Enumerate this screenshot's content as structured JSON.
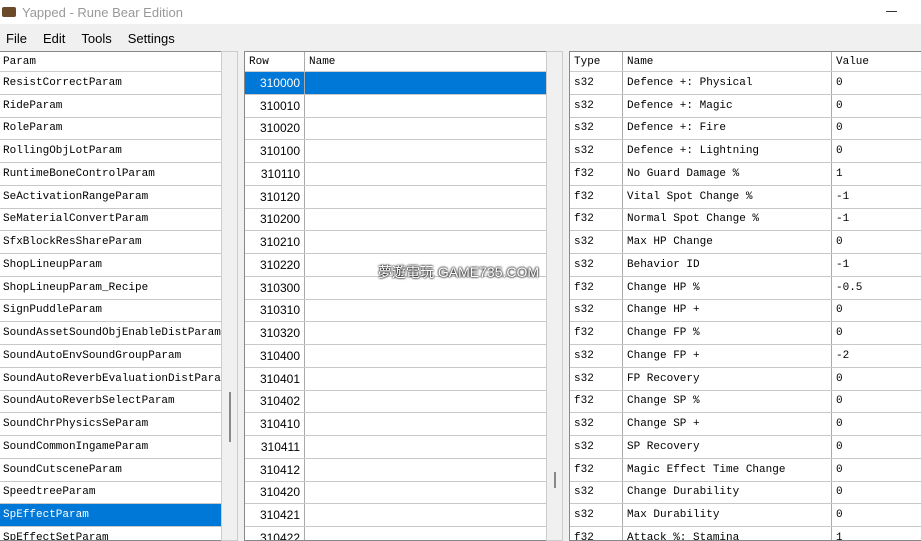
{
  "window": {
    "title": "Yapped - Rune Bear Edition"
  },
  "menu": [
    "File",
    "Edit",
    "Tools",
    "Settings"
  ],
  "params": {
    "header": "Param",
    "items": [
      "ResistCorrectParam",
      "RideParam",
      "RoleParam",
      "RollingObjLotParam",
      "RuntimeBoneControlParam",
      "SeActivationRangeParam",
      "SeMaterialConvertParam",
      "SfxBlockResShareParam",
      "ShopLineupParam",
      "ShopLineupParam_Recipe",
      "SignPuddleParam",
      "SoundAssetSoundObjEnableDistParam",
      "SoundAutoEnvSoundGroupParam",
      "SoundAutoReverbEvaluationDistParam",
      "SoundAutoReverbSelectParam",
      "SoundChrPhysicsSeParam",
      "SoundCommonIngameParam",
      "SoundCutsceneParam",
      "SpeedtreeParam",
      "SpEffectParam",
      "SpEffectSetParam"
    ],
    "selected": 19
  },
  "rows": {
    "header_row": "Row",
    "header_name": "Name",
    "items": [
      "310000",
      "310010",
      "310020",
      "310100",
      "310110",
      "310120",
      "310200",
      "310210",
      "310220",
      "310300",
      "310310",
      "310320",
      "310400",
      "310401",
      "310402",
      "310410",
      "310411",
      "310412",
      "310420",
      "310421",
      "310422"
    ],
    "selected": 0
  },
  "fields": {
    "header_type": "Type",
    "header_name": "Name",
    "header_value": "Value",
    "items": [
      [
        "s32",
        "Defence +: Physical",
        "0"
      ],
      [
        "s32",
        "Defence +: Magic",
        "0"
      ],
      [
        "s32",
        "Defence +: Fire",
        "0"
      ],
      [
        "s32",
        "Defence +: Lightning",
        "0"
      ],
      [
        "f32",
        "No Guard Damage %",
        "1"
      ],
      [
        "f32",
        "Vital Spot Change %",
        "-1"
      ],
      [
        "f32",
        "Normal Spot Change %",
        "-1"
      ],
      [
        "s32",
        "Max HP Change",
        "0"
      ],
      [
        "s32",
        "Behavior ID",
        "-1"
      ],
      [
        "f32",
        "Change HP %",
        "-0.5"
      ],
      [
        "s32",
        "Change HP +",
        "0"
      ],
      [
        "f32",
        "Change FP %",
        "0"
      ],
      [
        "s32",
        "Change FP +",
        "-2"
      ],
      [
        "s32",
        "FP Recovery",
        "0"
      ],
      [
        "f32",
        "Change SP %",
        "0"
      ],
      [
        "s32",
        "Change SP +",
        "0"
      ],
      [
        "s32",
        "SP Recovery",
        "0"
      ],
      [
        "f32",
        "Magic Effect Time Change",
        "0"
      ],
      [
        "s32",
        "Change Durability",
        "0"
      ],
      [
        "s32",
        "Max Durability",
        "0"
      ],
      [
        "f32",
        "Attack %: Stamina",
        "1"
      ]
    ]
  },
  "watermark": "夢遊電玩 GAME735.COM"
}
